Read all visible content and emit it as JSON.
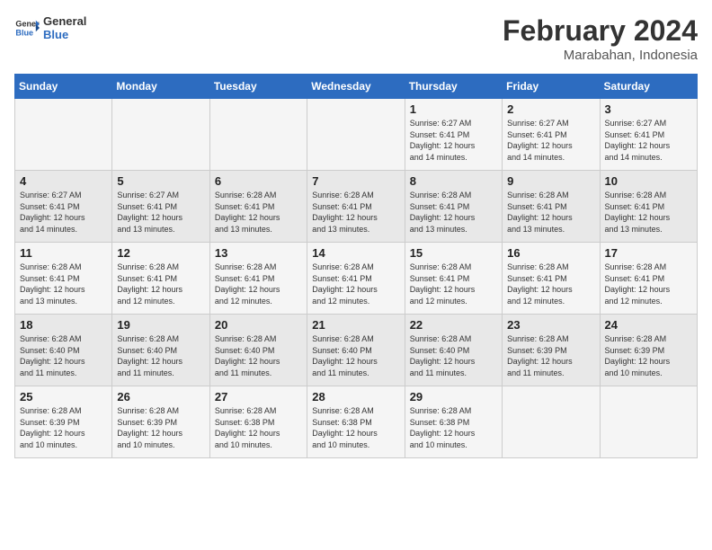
{
  "logo": {
    "text_general": "General",
    "text_blue": "Blue"
  },
  "title": "February 2024",
  "subtitle": "Marabahan, Indonesia",
  "days_of_week": [
    "Sunday",
    "Monday",
    "Tuesday",
    "Wednesday",
    "Thursday",
    "Friday",
    "Saturday"
  ],
  "weeks": [
    [
      {
        "day": "",
        "info": ""
      },
      {
        "day": "",
        "info": ""
      },
      {
        "day": "",
        "info": ""
      },
      {
        "day": "",
        "info": ""
      },
      {
        "day": "1",
        "info": "Sunrise: 6:27 AM\nSunset: 6:41 PM\nDaylight: 12 hours\nand 14 minutes."
      },
      {
        "day": "2",
        "info": "Sunrise: 6:27 AM\nSunset: 6:41 PM\nDaylight: 12 hours\nand 14 minutes."
      },
      {
        "day": "3",
        "info": "Sunrise: 6:27 AM\nSunset: 6:41 PM\nDaylight: 12 hours\nand 14 minutes."
      }
    ],
    [
      {
        "day": "4",
        "info": "Sunrise: 6:27 AM\nSunset: 6:41 PM\nDaylight: 12 hours\nand 14 minutes."
      },
      {
        "day": "5",
        "info": "Sunrise: 6:27 AM\nSunset: 6:41 PM\nDaylight: 12 hours\nand 13 minutes."
      },
      {
        "day": "6",
        "info": "Sunrise: 6:28 AM\nSunset: 6:41 PM\nDaylight: 12 hours\nand 13 minutes."
      },
      {
        "day": "7",
        "info": "Sunrise: 6:28 AM\nSunset: 6:41 PM\nDaylight: 12 hours\nand 13 minutes."
      },
      {
        "day": "8",
        "info": "Sunrise: 6:28 AM\nSunset: 6:41 PM\nDaylight: 12 hours\nand 13 minutes."
      },
      {
        "day": "9",
        "info": "Sunrise: 6:28 AM\nSunset: 6:41 PM\nDaylight: 12 hours\nand 13 minutes."
      },
      {
        "day": "10",
        "info": "Sunrise: 6:28 AM\nSunset: 6:41 PM\nDaylight: 12 hours\nand 13 minutes."
      }
    ],
    [
      {
        "day": "11",
        "info": "Sunrise: 6:28 AM\nSunset: 6:41 PM\nDaylight: 12 hours\nand 13 minutes."
      },
      {
        "day": "12",
        "info": "Sunrise: 6:28 AM\nSunset: 6:41 PM\nDaylight: 12 hours\nand 12 minutes."
      },
      {
        "day": "13",
        "info": "Sunrise: 6:28 AM\nSunset: 6:41 PM\nDaylight: 12 hours\nand 12 minutes."
      },
      {
        "day": "14",
        "info": "Sunrise: 6:28 AM\nSunset: 6:41 PM\nDaylight: 12 hours\nand 12 minutes."
      },
      {
        "day": "15",
        "info": "Sunrise: 6:28 AM\nSunset: 6:41 PM\nDaylight: 12 hours\nand 12 minutes."
      },
      {
        "day": "16",
        "info": "Sunrise: 6:28 AM\nSunset: 6:41 PM\nDaylight: 12 hours\nand 12 minutes."
      },
      {
        "day": "17",
        "info": "Sunrise: 6:28 AM\nSunset: 6:41 PM\nDaylight: 12 hours\nand 12 minutes."
      }
    ],
    [
      {
        "day": "18",
        "info": "Sunrise: 6:28 AM\nSunset: 6:40 PM\nDaylight: 12 hours\nand 11 minutes."
      },
      {
        "day": "19",
        "info": "Sunrise: 6:28 AM\nSunset: 6:40 PM\nDaylight: 12 hours\nand 11 minutes."
      },
      {
        "day": "20",
        "info": "Sunrise: 6:28 AM\nSunset: 6:40 PM\nDaylight: 12 hours\nand 11 minutes."
      },
      {
        "day": "21",
        "info": "Sunrise: 6:28 AM\nSunset: 6:40 PM\nDaylight: 12 hours\nand 11 minutes."
      },
      {
        "day": "22",
        "info": "Sunrise: 6:28 AM\nSunset: 6:40 PM\nDaylight: 12 hours\nand 11 minutes."
      },
      {
        "day": "23",
        "info": "Sunrise: 6:28 AM\nSunset: 6:39 PM\nDaylight: 12 hours\nand 11 minutes."
      },
      {
        "day": "24",
        "info": "Sunrise: 6:28 AM\nSunset: 6:39 PM\nDaylight: 12 hours\nand 10 minutes."
      }
    ],
    [
      {
        "day": "25",
        "info": "Sunrise: 6:28 AM\nSunset: 6:39 PM\nDaylight: 12 hours\nand 10 minutes."
      },
      {
        "day": "26",
        "info": "Sunrise: 6:28 AM\nSunset: 6:39 PM\nDaylight: 12 hours\nand 10 minutes."
      },
      {
        "day": "27",
        "info": "Sunrise: 6:28 AM\nSunset: 6:38 PM\nDaylight: 12 hours\nand 10 minutes."
      },
      {
        "day": "28",
        "info": "Sunrise: 6:28 AM\nSunset: 6:38 PM\nDaylight: 12 hours\nand 10 minutes."
      },
      {
        "day": "29",
        "info": "Sunrise: 6:28 AM\nSunset: 6:38 PM\nDaylight: 12 hours\nand 10 minutes."
      },
      {
        "day": "",
        "info": ""
      },
      {
        "day": "",
        "info": ""
      }
    ]
  ]
}
